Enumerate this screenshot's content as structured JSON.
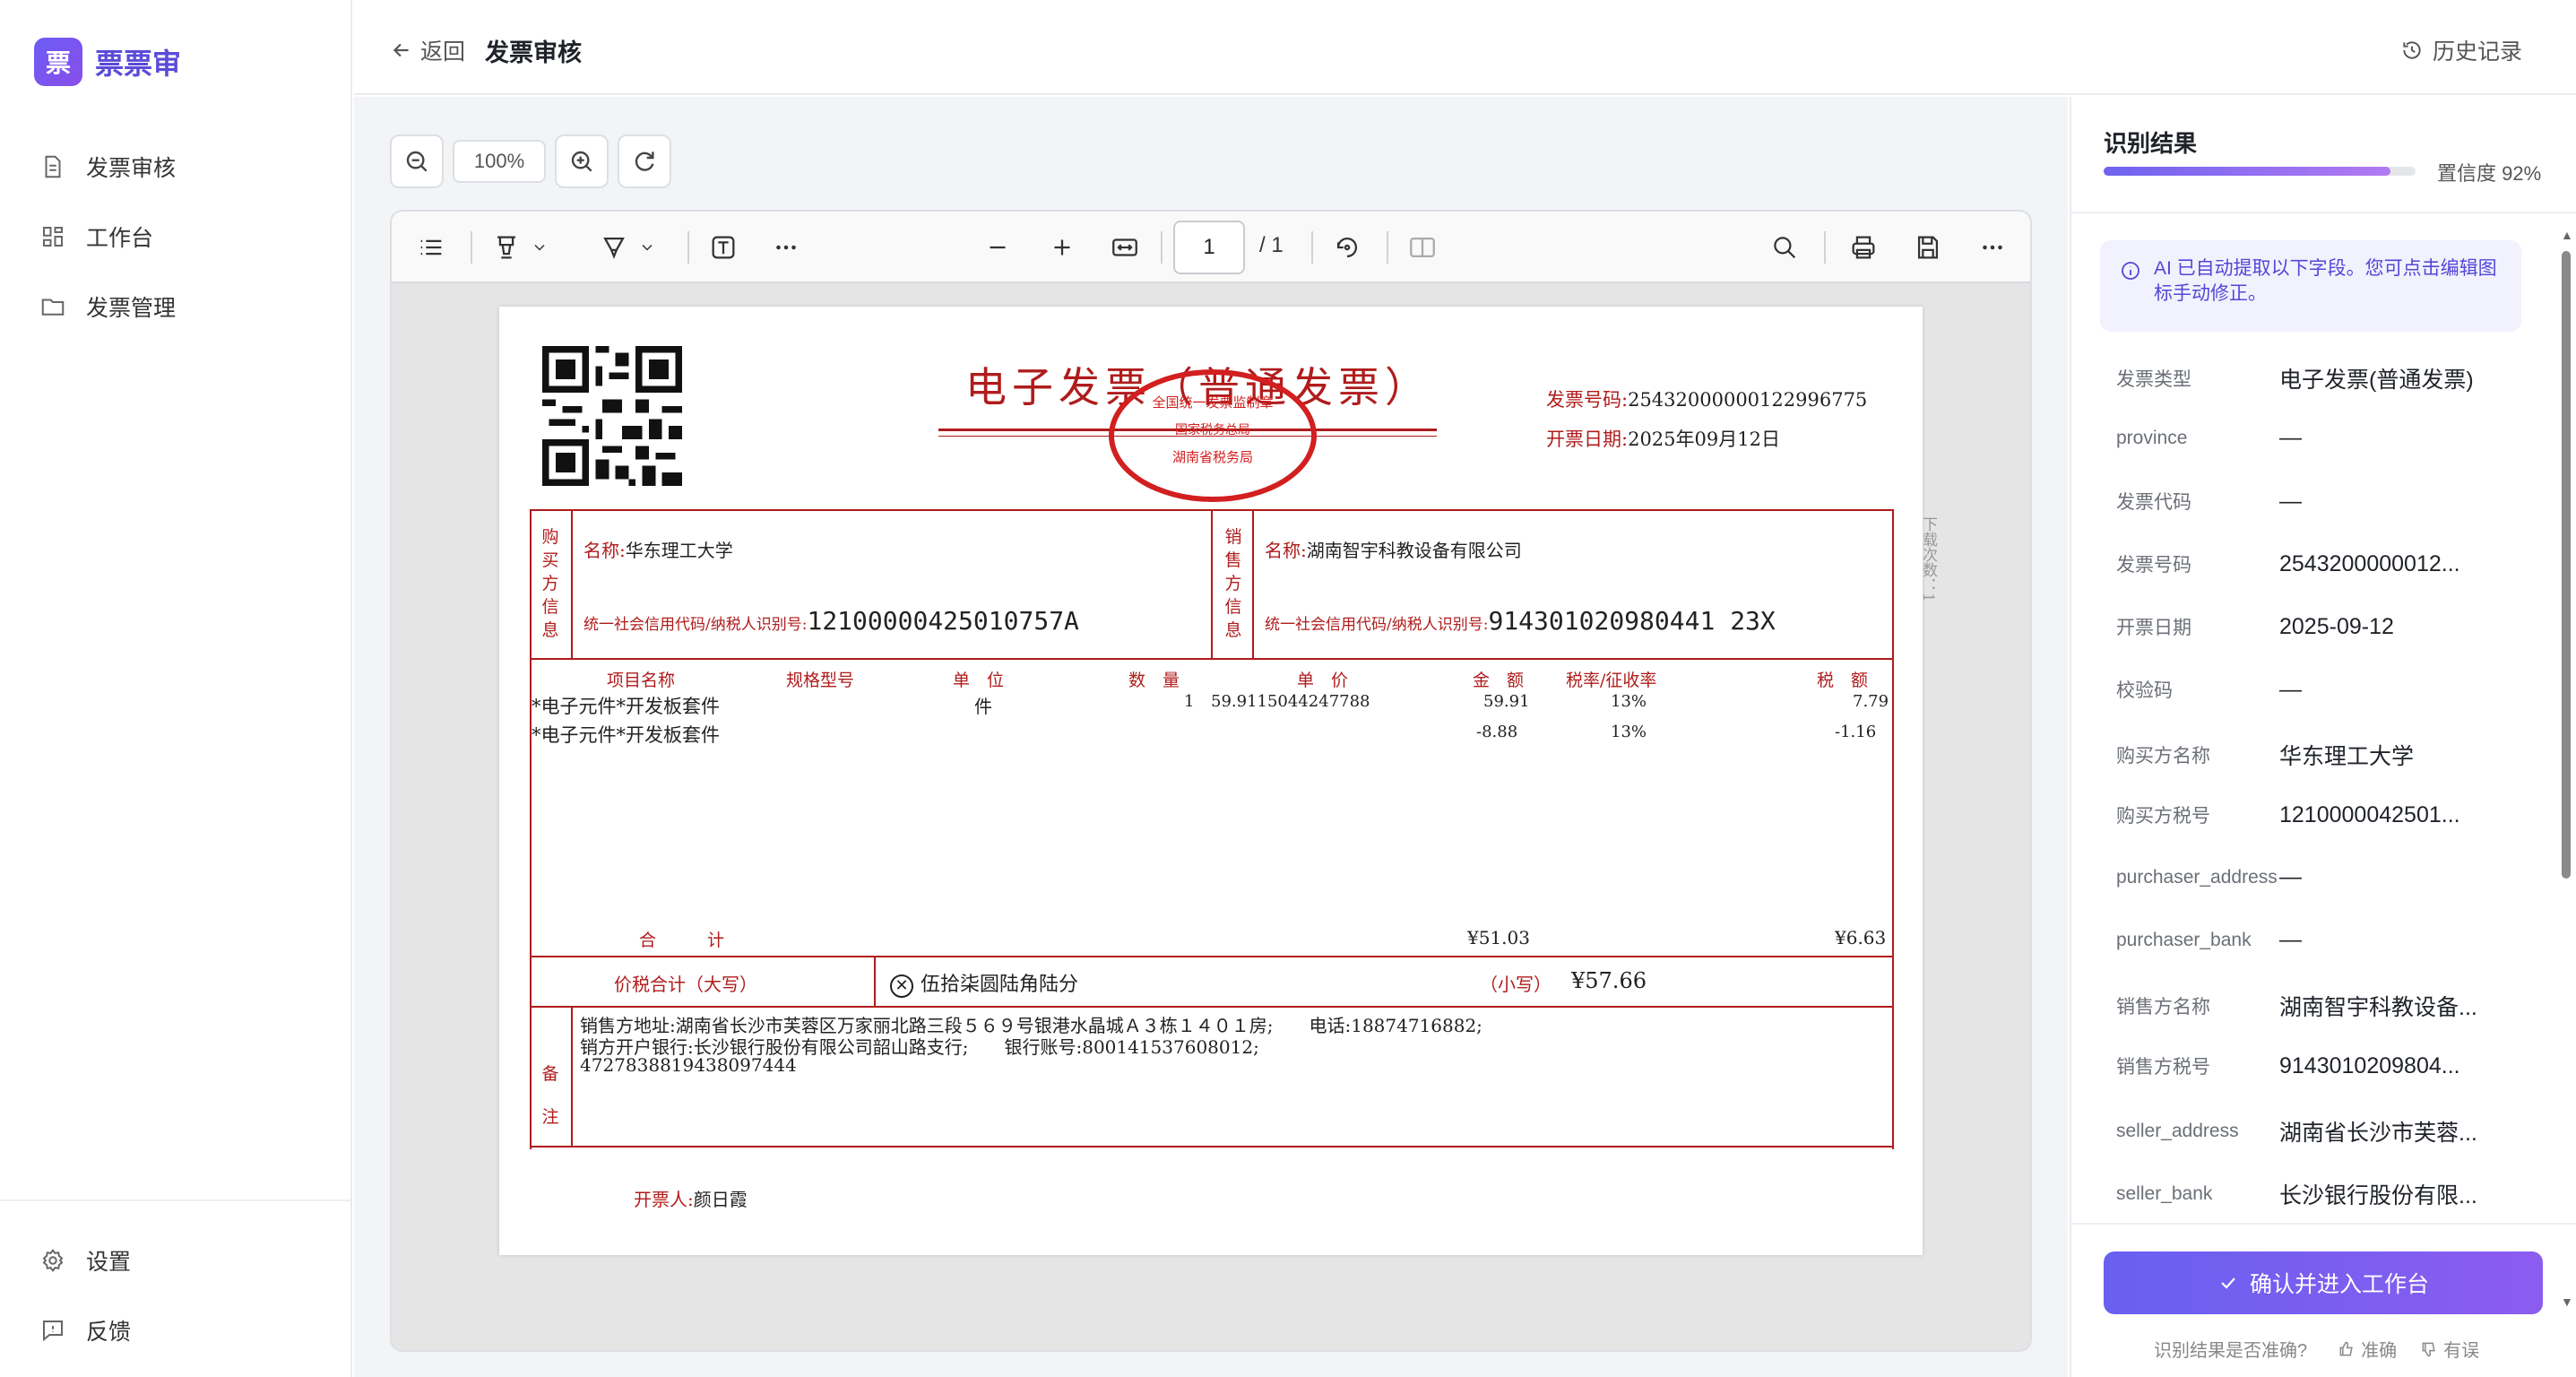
{
  "sidebar": {
    "logo_mark": "票",
    "logo_text": "票票审",
    "items": [
      {
        "label": "发票审核",
        "icon": "document-icon"
      },
      {
        "label": "工作台",
        "icon": "grid-icon"
      },
      {
        "label": "发票管理",
        "icon": "folder-icon"
      }
    ],
    "bottom_items": [
      {
        "label": "设置",
        "icon": "gear-icon"
      },
      {
        "label": "反馈",
        "icon": "feedback-icon"
      }
    ]
  },
  "header": {
    "back_label": "返回",
    "title": "发票审核",
    "history_label": "历史记录"
  },
  "viewer": {
    "zoom_label": "100%",
    "page_current": "1",
    "page_total": "/ 1"
  },
  "invoice": {
    "title": "电子发票（普通发票）",
    "number_label": "发票号码:",
    "number": "25432000000122996775",
    "date_label": "开票日期:",
    "date": "2025年09月12日",
    "stamp_top": "全国统一发票监制章",
    "stamp_mid": "国家税务总局",
    "stamp_bottom": "湖南省税务局",
    "side_note": "下载次数：1",
    "buyer_label": "购买方信息",
    "buyer_name_label": "名称:",
    "buyer_name": "华东理工大学",
    "buyer_tax_label": "统一社会信用代码/纳税人识别号:",
    "buyer_tax": "12100000425010757A",
    "seller_label": "销售方信息",
    "seller_name_label": "名称:",
    "seller_name": "湖南智宇科教设备有限公司",
    "seller_tax_label": "统一社会信用代码/纳税人识别号:",
    "seller_tax": "914301020980441 23X",
    "headers": [
      "项目名称",
      "规格型号",
      "单　位",
      "数　量",
      "单　价",
      "金　额",
      "税率/征收率",
      "税　额"
    ],
    "rows": [
      {
        "name": "*电子元件*开发板套件",
        "spec": "",
        "unit": "件",
        "qty": "1",
        "price": "59.9115044247788",
        "amount": "59.91",
        "rate": "13%",
        "tax": "7.79"
      },
      {
        "name": "*电子元件*开发板套件",
        "spec": "",
        "unit": "",
        "qty": "",
        "price": "",
        "amount": "-8.88",
        "rate": "13%",
        "tax": "-1.16"
      }
    ],
    "total_label": "合　　　计",
    "total_amount": "¥51.03",
    "total_tax": "¥6.63",
    "grand_label": "价税合计（大写）",
    "grand_words": "伍拾柒圆陆角陆分",
    "grand_small_label": "（小写）",
    "grand_small": "¥57.66",
    "remark_label": "备注",
    "remark_lines": [
      "销售方地址:湖南省长沙市芙蓉区万家丽北路三段５６９号银港水晶城Ａ３栋１４０１房;　　电话:18874716882;",
      "销方开户银行:长沙银行股份有限公司韶山路支行;　　银行账号:800141537608012;",
      "4727838819438097444"
    ],
    "issuer_label": "开票人:",
    "issuer": "颜日霞"
  },
  "result": {
    "title": "识别结果",
    "confidence_label": "置信度 92%",
    "confidence": 0.92,
    "note": "AI 已自动提取以下字段。您可点击编辑图标手动修正。",
    "fields": [
      {
        "key": "发票类型",
        "value": "电子发票(普通发票)"
      },
      {
        "key": "province",
        "value": "—"
      },
      {
        "key": "发票代码",
        "value": "—"
      },
      {
        "key": "发票号码",
        "value": "2543200000012..."
      },
      {
        "key": "开票日期",
        "value": "2025-09-12"
      },
      {
        "key": "校验码",
        "value": "—"
      },
      {
        "key": "购买方名称",
        "value": "华东理工大学"
      },
      {
        "key": "购买方税号",
        "value": "1210000042501..."
      },
      {
        "key": "purchaser_address",
        "value": "—"
      },
      {
        "key": "purchaser_bank",
        "value": "—"
      },
      {
        "key": "销售方名称",
        "value": "湖南智宇科教设备..."
      },
      {
        "key": "销售方税号",
        "value": "9143010209804..."
      },
      {
        "key": "seller_address",
        "value": "湖南省长沙市芙蓉..."
      },
      {
        "key": "seller_bank",
        "value": "长沙银行股份有限..."
      }
    ],
    "confirm_label": "确认并进入工作台",
    "feedback_question": "识别结果是否准确?",
    "feedback_yes": "准确",
    "feedback_no": "有误"
  },
  "colors": {
    "accent": "#6b5cf6",
    "invoice_red": "#b01c1c",
    "stamp_red": "#d21f1f"
  }
}
